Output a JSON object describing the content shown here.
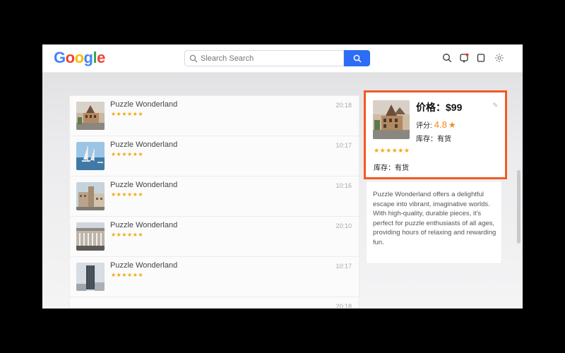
{
  "header": {
    "logo_letters": [
      {
        "ch": "G",
        "color": "#4285F4"
      },
      {
        "ch": "o",
        "color": "#EA4335"
      },
      {
        "ch": "o",
        "color": "#FBBC05"
      },
      {
        "ch": "g",
        "color": "#4285F4"
      },
      {
        "ch": "l",
        "color": "#34A853"
      },
      {
        "ch": "e",
        "color": "#EA4335"
      }
    ],
    "search_placeholder": "Slearch Search",
    "icons": [
      "search-icon",
      "notification-icon",
      "bookmark-icon",
      "settings-icon"
    ]
  },
  "list": {
    "items": [
      {
        "title": "Puzzle Wonderland",
        "stars": "★★★★★★",
        "time": "20:18"
      },
      {
        "title": "Puzzle Wonderland",
        "stars": "★★★★★★",
        "time": "10:17"
      },
      {
        "title": "Puzzle Wonderland",
        "stars": "★★★★★★",
        "time": "10:16"
      },
      {
        "title": "Puzzle Wonderland",
        "stars": "★★★★★★",
        "time": "20:10"
      },
      {
        "title": "Puzzle Wonderland",
        "stars": "★★★★★★",
        "time": "10:17"
      },
      {
        "title": "",
        "stars": "",
        "time": "20:18"
      }
    ]
  },
  "detail": {
    "price": "价格：$99",
    "rating_label": "评分:",
    "rating_value": "4.8",
    "rating_star": "★",
    "stock_line1": "库存：有货",
    "stars": "★★★★★★",
    "stock_line2": "库存：有货",
    "description": "Puzzle Wonderland offers a delightful escape into vibrant, imaginative worlds. With high-quality, durable pieces, it's perfect for puzzle enthusiasts of all ages, providing hours of relaxing and rewarding fun."
  },
  "colors": {
    "accent": "#2c6cf6",
    "highlight_border": "#f05a24",
    "star": "#f3a712",
    "rating": "#f08a1e"
  }
}
